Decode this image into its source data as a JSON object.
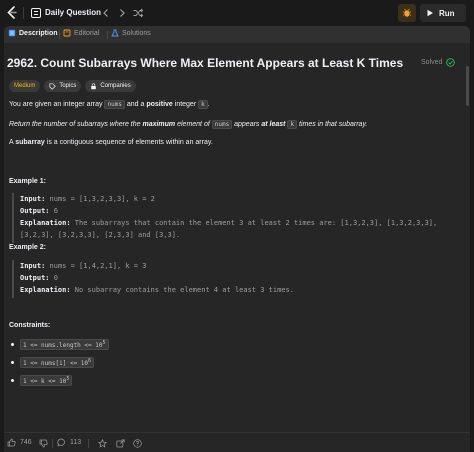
{
  "topbar": {
    "title": "Daily Question",
    "run_label": "Run"
  },
  "tabs": [
    {
      "label": "Description",
      "active": true
    },
    {
      "label": "Editorial",
      "active": false
    },
    {
      "label": "Solutions",
      "active": false
    }
  ],
  "problem": {
    "title": "2962. Count Subarrays Where Max Element Appears at Least K Times",
    "status": "Solved",
    "tags": [
      "Medium",
      "Topics",
      "Companies"
    ],
    "p1": {
      "a": "You are given an integer array ",
      "code1": "nums",
      "b": " and a ",
      "bold1": "positive",
      "c": " integer ",
      "code2": "k",
      "d": "."
    },
    "p2": {
      "a": "Return the number of subarrays where the ",
      "bold1": "maximum",
      "b": " element of ",
      "code1": "nums",
      "c": " appears ",
      "bold2": "at least",
      "d": " ",
      "code2": "k",
      "e": " times in that subarray."
    },
    "p3": {
      "a": "A ",
      "bold1": "subarray",
      "b": " is a contiguous sequence of elements within an array."
    }
  },
  "examples": [
    {
      "heading": "Example 1:",
      "input_label": "Input:",
      "input": " nums = [1,3,2,3,3], k = 2",
      "output_label": "Output:",
      "output": " 6",
      "explanation_label": "Explanation:",
      "explanation_1": " The subarrays that contain the element 3 at least 2 times are: [1,3,2,3], [1,3,2,3,3],",
      "explanation_2": "[3,2,3], [3,2,3,3], [2,3,3] and [3,3]."
    },
    {
      "heading": "Example 2:",
      "input_label": "Input:",
      "input": " nums = [1,4,2,1], k = 3",
      "output_label": "Output:",
      "output": " 0",
      "explanation_label": "Explanation:",
      "explanation_1": " No subarray contains the element 4 at least 3 times."
    }
  ],
  "constraints": {
    "heading": "Constraints:",
    "items": [
      {
        "text": "1 <= nums.length <= 10",
        "sup": "5"
      },
      {
        "text": "1 <= nums[i] <= 10",
        "sup": "6"
      },
      {
        "text": "1 <= k <= 10",
        "sup": "5"
      }
    ]
  },
  "bottombar": {
    "likes": "746",
    "comments": "113"
  },
  "colors": {
    "accent_medium": "#ffb800",
    "run_bg": "#2a2a2a",
    "debug_bg": "#3a2f1a"
  }
}
